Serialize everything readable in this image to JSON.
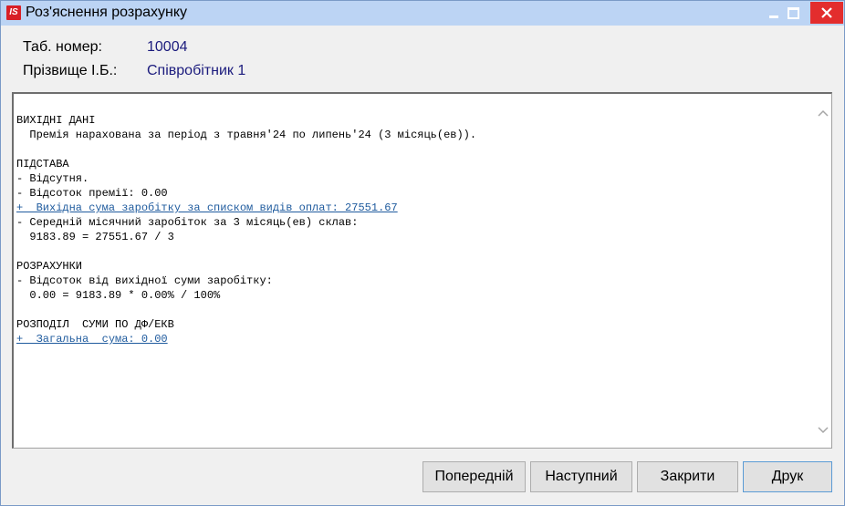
{
  "window": {
    "logo_text": "IS",
    "title": "Роз'яснення розрахунку"
  },
  "info": {
    "tab_label": "Таб. номер:",
    "tab_value": "10004",
    "name_label": "Прізвище І.Б.:",
    "name_value": "Співробітник 1"
  },
  "report": {
    "lines": [
      "ВИХІДНІ ДАНІ",
      "  Премія нарахована за період з травня'24 по липень'24 (3 місяць(ев)).",
      "",
      "ПІДСТАВА",
      "- Відсутня.",
      "- Відсоток премії: 0.00",
      "+  Вихідна сума заробітку за списком видів оплат: 27551.67",
      "- Середній місячний заробіток за 3 місяць(ев) склав:",
      "  9183.89 = 27551.67 / 3",
      "",
      "РОЗРАХУНКИ",
      "- Відсоток від вихідної суми заробітку:",
      "  0.00 = 9183.89 * 0.00% / 100%",
      "",
      "РОЗПОДІЛ  СУМИ ПО ДФ/ЕКВ",
      "+  Загальна  сума: 0.00"
    ],
    "link_lines": [
      6,
      15
    ]
  },
  "buttons": {
    "prev": "Попередній",
    "next": "Наступний",
    "close": "Закрити",
    "print": "Друк"
  },
  "colors": {
    "titlebar": "#bcd4f4",
    "close_button": "#e32d2d",
    "value_text": "#1b1b7d",
    "link_text": "#1f5b9e"
  }
}
